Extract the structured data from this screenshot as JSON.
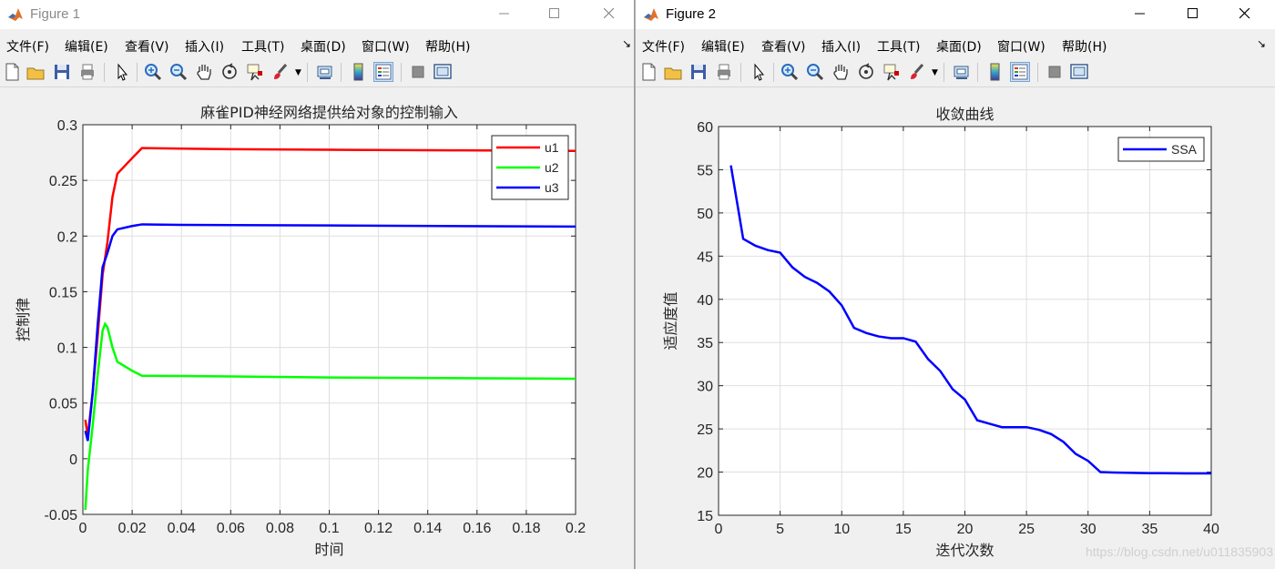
{
  "window1": {
    "title": "Figure 1",
    "menu": [
      "文件(F)",
      "编辑(E)",
      "查看(V)",
      "插入(I)",
      "工具(T)",
      "桌面(D)",
      "窗口(W)",
      "帮助(H)"
    ],
    "chart": {
      "title": "麻雀PID神经网络提供给对象的控制输入",
      "xlabel": "时间",
      "ylabel": "控制律",
      "x_ticks": [
        "0",
        "0.02",
        "0.04",
        "0.06",
        "0.08",
        "0.1",
        "0.12",
        "0.14",
        "0.16",
        "0.18",
        "0.2"
      ],
      "y_ticks": [
        "-0.05",
        "0",
        "0.05",
        "0.1",
        "0.15",
        "0.2",
        "0.25",
        "0.3"
      ],
      "legend": [
        "u1",
        "u2",
        "u3"
      ]
    }
  },
  "window2": {
    "title": "Figure 2",
    "menu": [
      "文件(F)",
      "编辑(E)",
      "查看(V)",
      "插入(I)",
      "工具(T)",
      "桌面(D)",
      "窗口(W)",
      "帮助(H)"
    ],
    "chart": {
      "title": "收敛曲线",
      "xlabel": "迭代次数",
      "ylabel": "适应度值",
      "x_ticks": [
        "0",
        "5",
        "10",
        "15",
        "20",
        "25",
        "30",
        "35",
        "40"
      ],
      "y_ticks": [
        "15",
        "20",
        "25",
        "30",
        "35",
        "40",
        "45",
        "50",
        "55",
        "60"
      ],
      "legend": [
        "SSA"
      ]
    }
  },
  "watermark": "https://blog.csdn.net/u011835903",
  "colors": {
    "u1": "#ff0000",
    "u2": "#00ff00",
    "u3": "#0000ff",
    "ssa": "#0000ff"
  },
  "chart_data": [
    {
      "type": "line",
      "title": "麻雀PID神经网络提供给对象的控制输入",
      "xlabel": "时间",
      "ylabel": "控制律",
      "xlim": [
        0,
        0.2
      ],
      "ylim": [
        -0.05,
        0.3
      ],
      "grid": true,
      "legend_position": "top-right",
      "series": [
        {
          "name": "u1",
          "color": "#ff0000",
          "x": [
            0.001,
            0.002,
            0.004,
            0.006,
            0.008,
            0.01,
            0.012,
            0.014,
            0.02,
            0.024,
            0.04,
            0.06,
            0.1,
            0.15,
            0.2
          ],
          "y": [
            0.035,
            0.02,
            0.06,
            0.11,
            0.165,
            0.195,
            0.235,
            0.256,
            0.27,
            0.279,
            0.2785,
            0.278,
            0.2775,
            0.277,
            0.2765
          ]
        },
        {
          "name": "u2",
          "color": "#00ff00",
          "x": [
            0.001,
            0.002,
            0.004,
            0.006,
            0.008,
            0.009,
            0.01,
            0.012,
            0.014,
            0.02,
            0.024,
            0.04,
            0.1,
            0.2
          ],
          "y": [
            -0.046,
            -0.01,
            0.03,
            0.075,
            0.115,
            0.121,
            0.118,
            0.1,
            0.087,
            0.079,
            0.0745,
            0.0743,
            0.073,
            0.0718
          ]
        },
        {
          "name": "u3",
          "color": "#0000ff",
          "x": [
            0.001,
            0.002,
            0.004,
            0.006,
            0.008,
            0.01,
            0.012,
            0.014,
            0.02,
            0.024,
            0.04,
            0.1,
            0.2
          ],
          "y": [
            0.025,
            0.016,
            0.06,
            0.12,
            0.172,
            0.185,
            0.2,
            0.206,
            0.209,
            0.2105,
            0.21,
            0.2095,
            0.2085
          ]
        }
      ]
    },
    {
      "type": "line",
      "title": "收敛曲线",
      "xlabel": "迭代次数",
      "ylabel": "适应度值",
      "xlim": [
        0,
        40
      ],
      "ylim": [
        15,
        60
      ],
      "grid": true,
      "legend_position": "top-right",
      "series": [
        {
          "name": "SSA",
          "color": "#0000ff",
          "x": [
            1,
            2,
            3,
            4,
            5,
            6,
            7,
            8,
            9,
            10,
            11,
            12,
            13,
            14,
            15,
            16,
            17,
            18,
            19,
            20,
            21,
            22,
            23,
            24,
            25,
            26,
            27,
            28,
            29,
            30,
            31,
            32,
            33,
            34,
            35,
            36,
            37,
            38,
            39,
            40
          ],
          "y": [
            55.5,
            47.0,
            46.2,
            45.7,
            45.4,
            43.7,
            42.6,
            41.9,
            40.9,
            39.3,
            36.7,
            36.1,
            35.7,
            35.5,
            35.5,
            35.1,
            33.1,
            31.7,
            29.6,
            28.4,
            26.0,
            25.6,
            25.2,
            25.2,
            25.2,
            24.9,
            24.4,
            23.5,
            22.1,
            21.3,
            20.0,
            19.95,
            19.92,
            19.9,
            19.88,
            19.87,
            19.86,
            19.85,
            19.85,
            19.85
          ]
        }
      ]
    }
  ]
}
